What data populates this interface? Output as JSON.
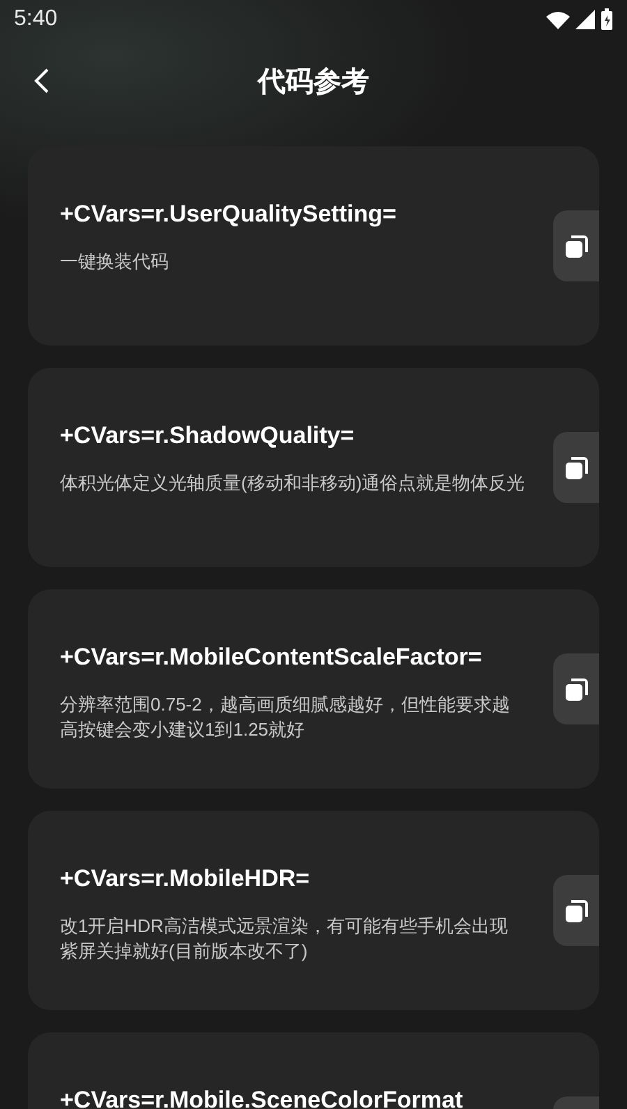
{
  "status_bar": {
    "time": "5:40"
  },
  "header": {
    "title": "代码参考"
  },
  "items": [
    {
      "code": "+CVars=r.UserQualitySetting=",
      "description": "一键换装代码"
    },
    {
      "code": "+CVars=r.ShadowQuality=",
      "description": "体积光体定义光轴质量(移动和非移动)通俗点就是物体反光"
    },
    {
      "code": "+CVars=r.MobileContentScaleFactor=",
      "description": "分辨率范围0.75-2，越高画质细腻感越好，但性能要求越高按键会变小建议1到1.25就好"
    },
    {
      "code": "+CVars=r.MobileHDR=",
      "description": "改1开启HDR高洁模式远景渲染，有可能有些手机会出现紫屏关掉就好(目前版本改不了)"
    },
    {
      "code": "+CVars=r.Mobile.SceneColorFormat"
    }
  ]
}
